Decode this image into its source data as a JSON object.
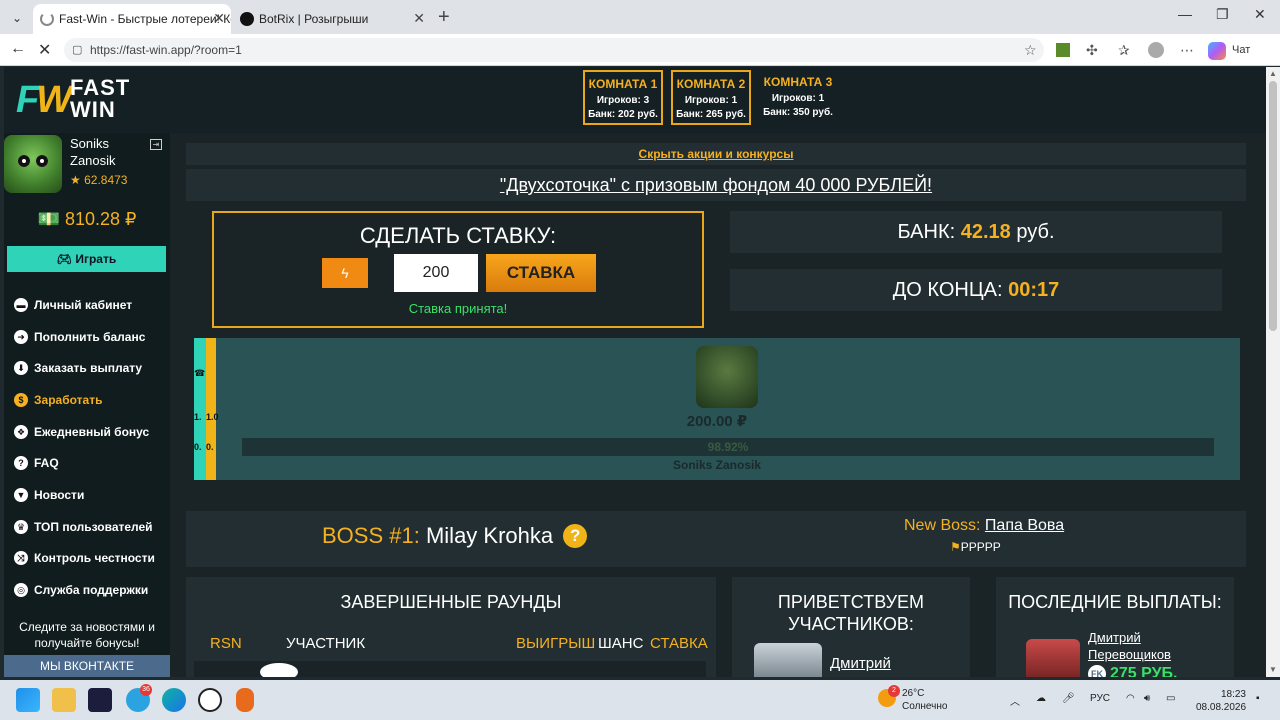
{
  "browser": {
    "tabs": [
      {
        "title": "Fast-Win - Быстрые лотереи! Ком",
        "active": true
      },
      {
        "title": "BotRix | Розыгрыши",
        "active": false
      }
    ],
    "url": "https://fast-win.app/?room=1",
    "chat_label": "Чат"
  },
  "site": {
    "logo_text": "FAST\nWIN",
    "logo_mark": "FW",
    "rooms": [
      {
        "title": "КОМНАТА 1",
        "players": "Игроков: 3",
        "bank": "Банк: 202 руб.",
        "selected": true
      },
      {
        "title": "КОМНАТА 2",
        "players": "Игроков: 1",
        "bank": "Банк: 265 руб.",
        "selected": true
      },
      {
        "title": "КОМНАТА 3",
        "players": "Игроков: 1",
        "bank": "Банк: 350 руб.",
        "selected": false
      }
    ]
  },
  "sidebar": {
    "user_name": "Soniks Zanosik",
    "rating": "★ 62.8473",
    "balance": "💵 810.28 ₽",
    "play_label": "Играть",
    "menu": [
      {
        "label": "Личный кабинет",
        "icon": "briefcase-icon",
        "glyph": "▬",
        "highlight": false
      },
      {
        "label": "Пополнить баланс",
        "icon": "arrow-right-circle-icon",
        "glyph": "➜",
        "highlight": false
      },
      {
        "label": "Заказать выплату",
        "icon": "arrow-down-circle-icon",
        "glyph": "⬇",
        "highlight": false
      },
      {
        "label": "Заработать",
        "icon": "money-icon",
        "glyph": "$",
        "highlight": true
      },
      {
        "label": "Ежедневный бонус",
        "icon": "gift-icon",
        "glyph": "❖",
        "highlight": false
      },
      {
        "label": "FAQ",
        "icon": "question-icon",
        "glyph": "?",
        "highlight": false
      },
      {
        "label": "Новости",
        "icon": "bookmark-icon",
        "glyph": "▼",
        "highlight": false
      },
      {
        "label": "ТОП пользователей",
        "icon": "trophy-icon",
        "glyph": "♛",
        "highlight": false
      },
      {
        "label": "Контроль честности",
        "icon": "shuffle-icon",
        "glyph": "⤨",
        "highlight": false
      },
      {
        "label": "Служба поддержки",
        "icon": "lifebuoy-icon",
        "glyph": "◎",
        "highlight": false
      }
    ],
    "news_text": "Следите за новостями и получайте бонусы!",
    "vk_label": "МЫ ВКОНТАКТЕ"
  },
  "content": {
    "hide_promos": "Скрыть акции и конкурсы",
    "promo": "\"Двухсоточка\" с призовым фондом 40 000 РУБЛЕЙ!",
    "bet": {
      "title": "СДЕЛАТЬ СТАВКУ:",
      "value": "200",
      "button": "СТАВКА",
      "status": "Ставка принята!"
    },
    "bank": {
      "label": "БАНК:",
      "value": "42.18",
      "unit": "руб."
    },
    "timer": {
      "label": "ДО КОНЦА:",
      "value": "00:17"
    },
    "arena": {
      "strip_top": "1.",
      "strip_top2": "1.0",
      "strip_bottom": "0.",
      "strip_bottom2": "0.",
      "amount": "200.00 ₽",
      "chance": "98.92%",
      "name": "Soniks Zanosik"
    },
    "boss": {
      "label": "BOSS #1:",
      "name": "Milay Krohka",
      "new_boss_label": "New Boss:",
      "new_boss_name": "Папа Вова",
      "flags": "PPPPP"
    },
    "rounds": {
      "title": "ЗАВЕРШЕННЫЕ РАУНДЫ",
      "col_rsn": "RSN",
      "col_player": "УЧАСТНИК",
      "col_win": "ВЫИГРЫШ",
      "col_chance": "ШАНС",
      "col_bet": "СТАВКА"
    },
    "greet": {
      "title": "ПРИВЕТСТВУЕМ УЧАСТНИКОВ:",
      "name": "Дмитрий"
    },
    "payouts": {
      "title": "ПОСЛЕДНИЕ ВЫПЛАТЫ:",
      "name": "Дмитрий Перевощиков",
      "amount": "275 РУБ."
    }
  },
  "taskbar": {
    "weather_temp": "26°C",
    "weather_desc": "Солнечно",
    "weather_badge": "2",
    "telegram_badge": "36",
    "lang": "РУС",
    "time": "18:23",
    "date": "08.08.2026"
  }
}
